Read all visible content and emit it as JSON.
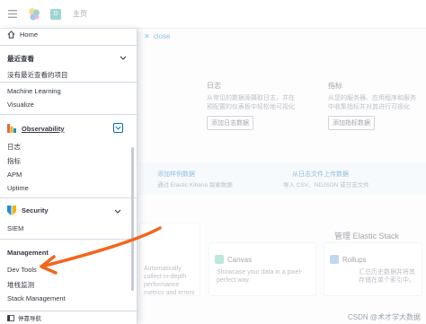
{
  "header": {
    "menu_icon": "hamburger-icon",
    "logo": "elastic-logo",
    "space_initial": "D",
    "breadcrumb": "主页"
  },
  "main": {
    "close_label": "close",
    "cards": [
      {
        "title": "日志",
        "text": "从常见的数据源摄取日志，并在预配置的仪表板中轻松地可视化",
        "button": "添加日志数据"
      },
      {
        "title": "指标",
        "text": "从您的服务器、应用程序和服务中收集指标并对其进行可视化",
        "button": "添加指标数据"
      }
    ],
    "sample_data": "添加样例数据",
    "sample_data_sub": "通过 Elastic Kibana 探索数据",
    "upload_file": "从日志文件上传数据",
    "upload_file_sub": "导入 CSV、NDJSON 或日志文件",
    "manage_stack_title": "管理 Elastic Stack",
    "canvas_title": "Canvas",
    "canvas_text": "Showcase your data in a pixel-perfect way.",
    "rollups_title": "Rollups",
    "rollups_text": "汇总历史数据并将其存储在单个索引中。",
    "apm_text": "Automatically collect in-depth performance metrics and errors from inside your",
    "watermark": "CSDN @术才学大数据"
  },
  "nav": {
    "home": "Home",
    "recent_heading": "最近查看",
    "recent_empty": "没有最近查看的项目",
    "analytics_items": [
      "Machine Learning",
      "Visualize"
    ],
    "observability_heading": "Observability",
    "observability_items": [
      "日志",
      "指标",
      "APM",
      "Uptime"
    ],
    "security_heading": "Security",
    "security_items": [
      "SIEM"
    ],
    "management_heading": "Management",
    "management_items": [
      "Dev Tools",
      "堆栈监测",
      "Stack Management"
    ],
    "dock_label": "停靠导航"
  },
  "colors": {
    "accent": "#006bb8",
    "annotation_arrow": "#f2661f",
    "space_badge": "#27a599"
  }
}
